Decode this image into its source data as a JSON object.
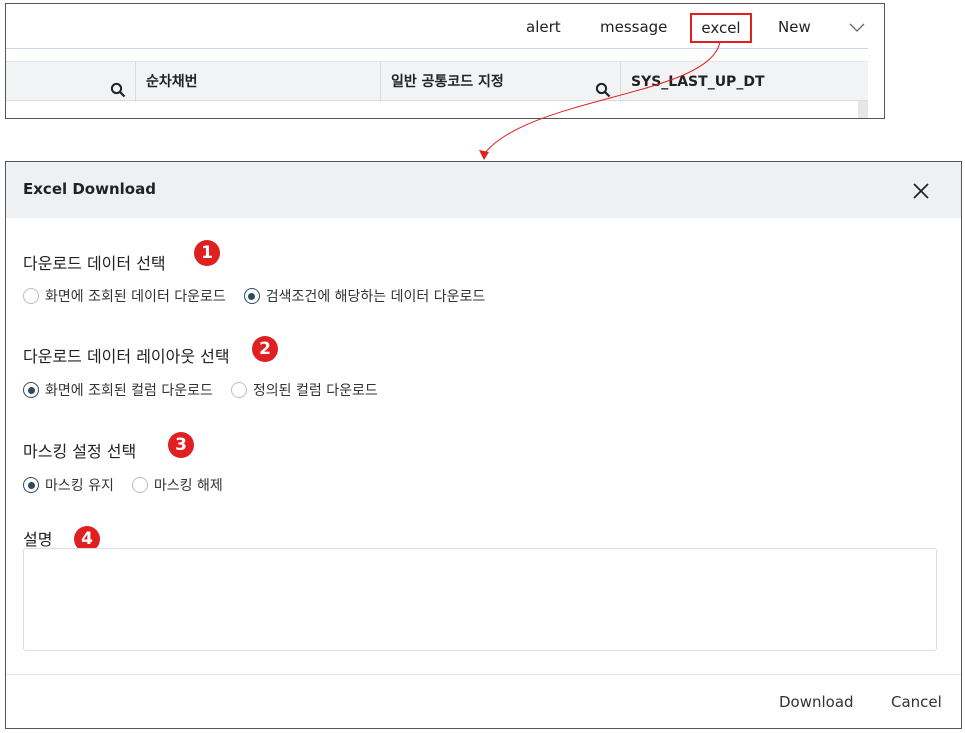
{
  "toolbar": {
    "alert": "alert",
    "message": "message",
    "excel": "excel",
    "new": "New",
    "more_icon": "chevron-down-icon"
  },
  "grid": {
    "columns": [
      "",
      "순차채번",
      "일반 공통코드 지정",
      "SYS_LAST_UP_DT"
    ],
    "peek_row": [
      "",
      "",
      "",
      ""
    ]
  },
  "dialog": {
    "title": "Excel Download",
    "section1": {
      "title": "다운로드 데이터 선택",
      "badge": "1",
      "options": [
        "화면에 조회된 데이터 다운로드",
        "검색조건에 해당하는 데이터 다운로드"
      ],
      "selected": 1
    },
    "section2": {
      "title": "다운로드 데이터 레이아웃 선택",
      "badge": "2",
      "options": [
        "화면에 조회된 컬럼 다운로드",
        "정의된 컬럼 다운로드"
      ],
      "selected": 0
    },
    "section3": {
      "title": "마스킹 설정 선택",
      "badge": "3",
      "options": [
        "마스킹 유지",
        "마스킹 해제"
      ],
      "selected": 0
    },
    "section4": {
      "title": "설명",
      "badge": "4",
      "value": ""
    },
    "download_label": "Download",
    "cancel_label": "Cancel"
  },
  "colors": {
    "highlight": "#e02020",
    "radio_selected": "#2c4a66",
    "header_bg": "#eef1f4"
  }
}
